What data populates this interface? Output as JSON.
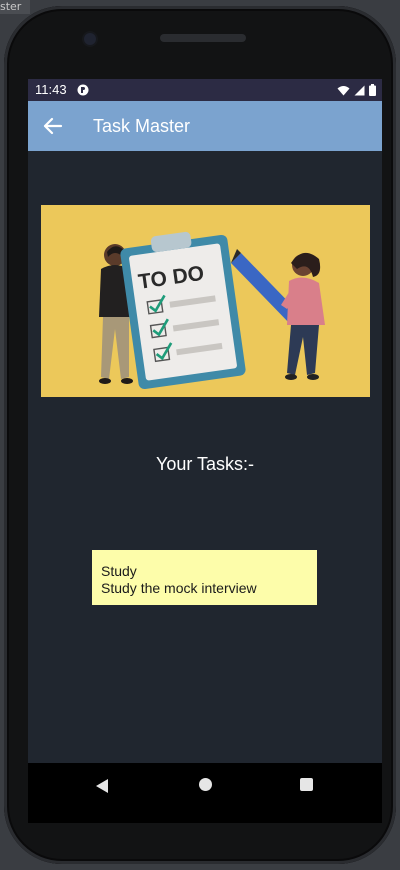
{
  "ide": {
    "corner_label": "ster"
  },
  "status_bar": {
    "time": "11:43",
    "icons": [
      "app-logo-icon",
      "wifi-icon",
      "signal-icon",
      "battery-icon"
    ]
  },
  "app_bar": {
    "title": "Task Master",
    "color": "#7ba3cf"
  },
  "hero": {
    "text": "TO DO",
    "background": "#ecc85a"
  },
  "tasks": {
    "heading": "Your Tasks:-",
    "items": [
      {
        "title": "Study",
        "description": "Study the mock interview"
      }
    ]
  },
  "colors": {
    "screen_background": "#20262f",
    "status_bar": "#2c2b44",
    "task_card": "#fdfdaa",
    "check": "#1e9c7a",
    "pencil": "#3a67c4"
  }
}
